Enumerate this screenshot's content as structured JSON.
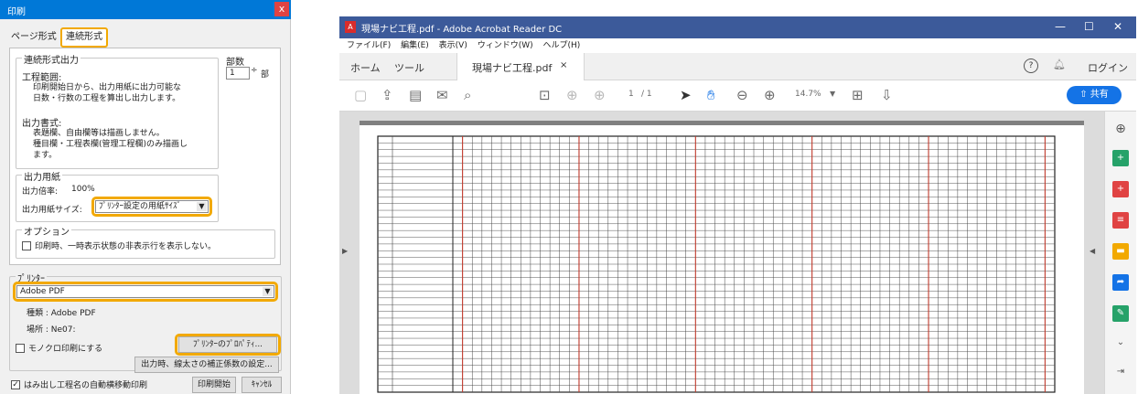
{
  "print_dialog": {
    "title": "印刷",
    "close_glyph": "x",
    "tabs": [
      "ページ形式",
      "連続形式"
    ],
    "continuous_output": {
      "group_title": "連続形式出力",
      "range_label": "工程範囲:",
      "range_desc_1": "印刷開始日から、出力用紙に出力可能な",
      "range_desc_2": "日数・行数の工程を算出し出力します。",
      "format_label": "出力書式:",
      "format_desc_1": "表題欄、自由欄等は描画しません。",
      "format_desc_2": "種目欄・工程表欄(管理工程欄)のみ描画し",
      "format_desc_3": "ます。"
    },
    "copies": {
      "label": "部数",
      "value": "1",
      "unit": "部"
    },
    "paper": {
      "group_title": "出力用紙",
      "ratio_label": "出力倍率:",
      "ratio_value": "100%",
      "size_label": "出力用紙サイズ:",
      "size_value": "ﾌﾟﾘﾝﾀｰ設定の用紙ｻｲｽﾞ"
    },
    "options": {
      "group_title": "オプション",
      "hide_label": "印刷時、一時表示状態の非表示行を表示しない。"
    },
    "printer": {
      "group_title": "ﾌﾟﾘﾝﾀｰ",
      "selected": "Adobe PDF",
      "type_label": "種類 : Adobe PDF",
      "location_label": "場所 : Ne07:",
      "mono_label": "モノクロ印刷にする",
      "properties_button": "ﾌﾟﾘﾝﾀｰのﾌﾟﾛﾊﾟﾃｨ...",
      "line_width_button": "出力時、線太さの補正係数の設定..."
    },
    "footer": {
      "auto_name_label": "はみ出し工程名の自動横移動印刷",
      "print_button": "印刷開始",
      "cancel_button": "ｷｬﾝｾﾙ"
    }
  },
  "acrobat": {
    "title": "現場ナビ工程.pdf - Adobe Acrobat Reader DC",
    "menu": [
      "ファイル(F)",
      "編集(E)",
      "表示(V)",
      "ウィンドウ(W)",
      "ヘルプ(H)"
    ],
    "tabs": [
      "ホーム",
      "ツール"
    ],
    "doc_tab": "現場ナビ工程.pdf",
    "doc_tab_close": "×",
    "help_glyph": "?",
    "login": "ログイン",
    "page_current": "1",
    "page_total": "/ 1",
    "zoom": "14.7%",
    "share_button": "共有",
    "grid": {
      "columns": 62,
      "rows": 38
    },
    "colors": {
      "titlebar": "#3c5a9a",
      "share": "#1473e6",
      "grid_red": "#c0392b"
    }
  }
}
